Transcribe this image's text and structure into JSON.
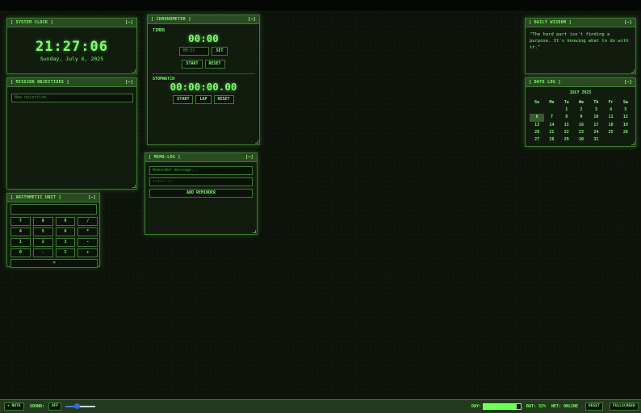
{
  "clock": {
    "title": "[ SYSTEM CLOCK ]",
    "min_label": "[–]",
    "time": "21:27:06",
    "date": "Sunday, July 6, 2025"
  },
  "objectives": {
    "title": "[ MISSION OBJECTIVES ]",
    "min_label": "[–]",
    "placeholder": "New objective..."
  },
  "calculator": {
    "title": "[ ARITHMETIC UNIT ]",
    "min_label": "[–]",
    "keys": [
      "7",
      "8",
      "9",
      "/",
      "4",
      "5",
      "6",
      "*",
      "1",
      "2",
      "3",
      "-",
      "0",
      ".",
      "C",
      "+"
    ],
    "equals": "="
  },
  "chronometer": {
    "title": "[ CHRONOMETER ]",
    "min_label": "[–]",
    "timer_label": "TIMER",
    "timer_display": "00:00",
    "timer_placeholder": "MM:SS",
    "set_label": "SET",
    "timer_start": "START",
    "timer_reset": "RESET",
    "stopwatch_label": "STOPWATCH",
    "stopwatch_display": "00:00:00.00",
    "sw_start": "START",
    "sw_lap": "LAP",
    "sw_reset": "RESET"
  },
  "memo": {
    "title": "[ MEMO-LOG ]",
    "min_label": "[–]",
    "msg_placeholder": "Reminder message...",
    "time_value": "--:-- --",
    "add_label": "ADD REMINDER"
  },
  "wisdom": {
    "title": "[ DAILY WISDOM ]",
    "min_label": "[–]",
    "quote": "\"The hard part isn't finding a purpose. It's knowing what to do with it.\""
  },
  "calendar": {
    "title": "[ DATE LOG ]",
    "min_label": "[–]",
    "month": "JULY 2025",
    "weekdays": [
      "Su",
      "Mo",
      "Tu",
      "We",
      "Th",
      "Fr",
      "Sa"
    ],
    "first_weekday_index": 2,
    "days_in_month": 31,
    "today": 6
  },
  "bottombar": {
    "note_label": "+ NOTE",
    "sound_label": "SOUND:",
    "sound_toggle": "OFF",
    "sound_volume_fraction": 0.4,
    "day_label": "DAY:",
    "day_fraction": 0.9,
    "battery_text": "BAT: 32%",
    "net_text": "NET: ONLINE",
    "reset_label": "RESET",
    "fullscreen_label": "FULLSCREEN"
  },
  "colors": {
    "accent": "#7dff6a",
    "panel_bg": "#111c0f",
    "border": "#3f7a33",
    "title_bg": "#2a4a22"
  }
}
